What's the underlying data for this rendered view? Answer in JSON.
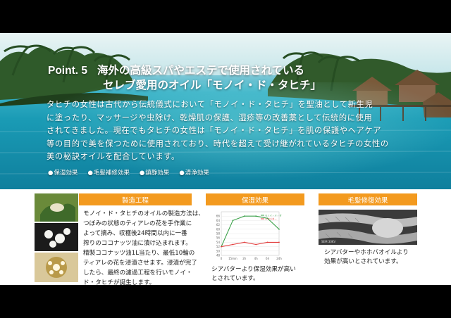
{
  "hero": {
    "point_label": "Point. 5",
    "title_line1": "海外の高級スパやエステで使用されている",
    "title_line2": "セレブ愛用のオイル「モノイ・ド・タヒチ」",
    "body_lines": [
      "タヒチの女性は古代から伝統儀式において「モノイ・ド・タヒチ」を聖油として新生児",
      "に塗ったり、マッサージや虫除け、乾燥肌の保護、湿疹等の改善薬として伝統的に使用",
      "されてきました。現在でもタヒチの女性は「モノイ・ド・タヒチ」を肌の保護やヘアケア",
      "等の目的で美を保つために使用されており、時代を超えて受け継がれているタヒチの女性の",
      "美の秘訣オイルを配合しています。"
    ],
    "effects": [
      "保湿効果",
      "毛髪補修効果",
      "鎮静効果",
      "清浄効果"
    ]
  },
  "manufacturing": {
    "title": "製造工程",
    "text_lines": [
      "モノイ・ド・タヒチのオイルの製造方法は、",
      "つぼみの状態のティアレの花を手作業に",
      "よって摘み、収穫後24時間以内に一番",
      "搾りのココナッツ油に漬け込まれます。",
      "精製ココナッツ油1L当たり、最低10輪の",
      "ティアレの花を浸漬させます。浸漬が完了",
      "したら、最終の濾過工程を行いモノイ・",
      "ド・タヒチが誕生します。"
    ]
  },
  "moisture": {
    "title": "保湿効果",
    "caption_lines": [
      "シアバターより保湿効果が高い",
      "とされています。"
    ]
  },
  "hair": {
    "title": "毛髪修復効果",
    "caption_lines": [
      "シアバターやホホバオイルより",
      "効果が高いとされています。"
    ],
    "photo_label": "SEM 30KV"
  },
  "chart_data": {
    "type": "line",
    "categories": [
      "0",
      "15min",
      "2h",
      "4h",
      "6h",
      "24h"
    ],
    "series": [
      {
        "name": "モノイ・ド・タヒチ",
        "color": "#3fa34d",
        "values": [
          52,
          64,
          66,
          66,
          65,
          60
        ]
      },
      {
        "name": "シアバター",
        "color": "#e23b3b",
        "values": [
          52,
          53,
          54,
          53,
          54,
          54
        ]
      }
    ],
    "yticks": [
      48,
      50,
      52,
      54,
      56,
      58,
      60,
      62,
      64,
      66
    ],
    "ylim": [
      48,
      68
    ],
    "legend": "top-right"
  },
  "colors": {
    "accent": "#f39a1f",
    "sea": "#1a9bb5"
  }
}
